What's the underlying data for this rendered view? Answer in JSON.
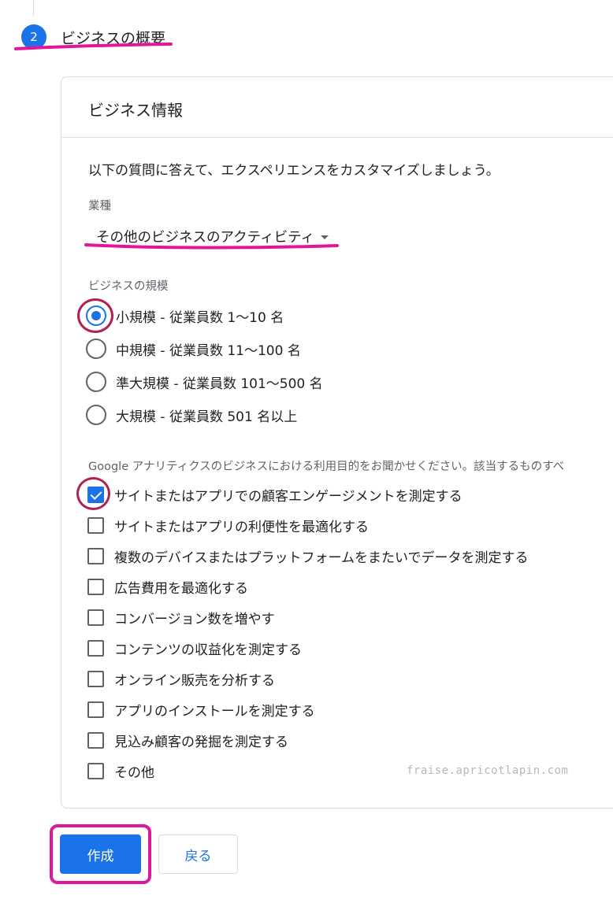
{
  "stepper": {
    "step_number": "2",
    "step_title": "ビジネスの概要"
  },
  "card": {
    "title": "ビジネス情報",
    "intro": "以下の質問に答えて、エクスペリエンスをカスタマイズしましょう。",
    "industry": {
      "label": "業種",
      "selected": "その他のビジネスのアクティビティ"
    },
    "business_size": {
      "label": "ビジネスの規模",
      "options": [
        {
          "label": "小規模 - 従業員数 1〜10 名",
          "selected": true
        },
        {
          "label": "中規模 - 従業員数 11〜100 名",
          "selected": false
        },
        {
          "label": "準大規模 - 従業員数 101〜500 名",
          "selected": false
        },
        {
          "label": "大規模 - 従業員数 501 名以上",
          "selected": false
        }
      ]
    },
    "purpose": {
      "label": "Google アナリティクスのビジネスにおける利用目的をお聞かせください。該当するものすべ",
      "options": [
        {
          "label": "サイトまたはアプリでの顧客エンゲージメントを測定する",
          "checked": true
        },
        {
          "label": "サイトまたはアプリの利便性を最適化する",
          "checked": false
        },
        {
          "label": "複数のデバイスまたはプラットフォームをまたいでデータを測定する",
          "checked": false
        },
        {
          "label": "広告費用を最適化する",
          "checked": false
        },
        {
          "label": "コンバージョン数を増やす",
          "checked": false
        },
        {
          "label": "コンテンツの収益化を測定する",
          "checked": false
        },
        {
          "label": "オンライン販売を分析する",
          "checked": false
        },
        {
          "label": "アプリのインストールを測定する",
          "checked": false
        },
        {
          "label": "見込み顧客の発掘を測定する",
          "checked": false
        },
        {
          "label": "その他",
          "checked": false
        }
      ]
    },
    "watermark": "fraise.apricotlapin.com"
  },
  "buttons": {
    "create": "作成",
    "back": "戻る"
  },
  "colors": {
    "accent": "#1a73e8",
    "annotation_magenta": "#e0179b",
    "annotation_crimson": "#b0214f"
  }
}
